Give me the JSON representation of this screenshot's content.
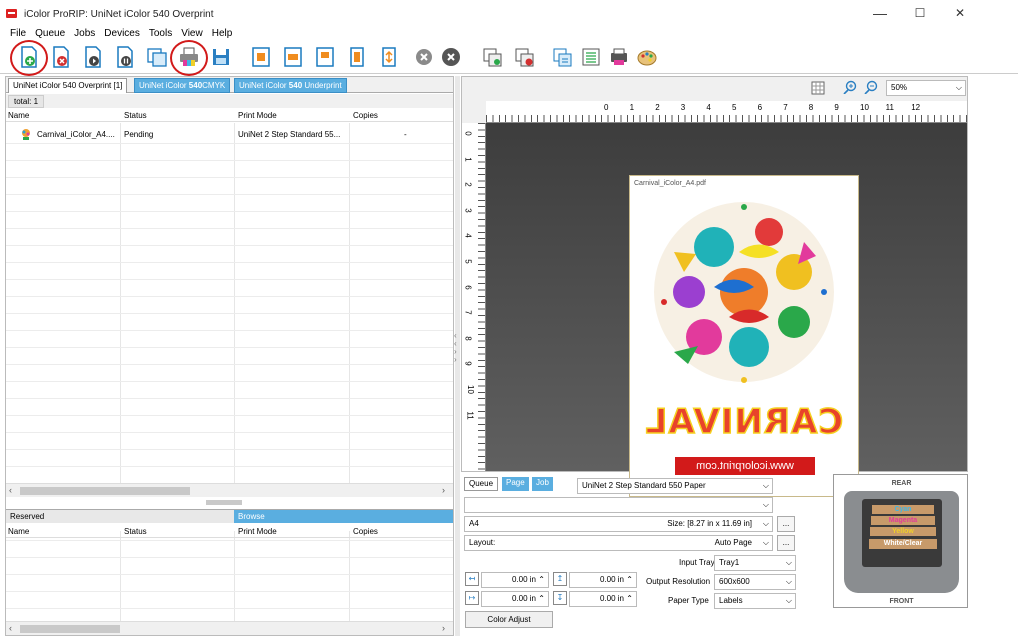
{
  "window": {
    "title": "iColor ProRIP: UniNet iColor 540 Overprint",
    "minimize": "—",
    "maximize": "☐",
    "close": "✕"
  },
  "menu": [
    "File",
    "Queue",
    "Jobs",
    "Devices",
    "Tools",
    "View",
    "Help"
  ],
  "toolbar": {
    "icons": [
      "add-job-icon",
      "delete-job-icon",
      "resume-job-icon",
      "hold-job-icon",
      "copy-job-icon",
      "print-icon",
      "save-icon",
      "fit-page-icon",
      "fit-width-icon",
      "fit-height-icon",
      "rotate-icon",
      "actual-size-icon",
      "cancel-icon",
      "stop-icon",
      "move-job-icon",
      "remove-job-icon",
      "queue-props-icon",
      "job-list-icon",
      "printer-settings-icon",
      "color-palette-icon"
    ],
    "circled": [
      "add-job-icon",
      "print-icon"
    ],
    "highlight_color": "#d21a1a"
  },
  "queue_tabs": [
    {
      "label_pre": "UniNet iColor 540 Overprint [1]",
      "active": true
    },
    {
      "label_pre": "UniNet iColor ",
      "label_bold": "540",
      "label_post": "CMYK",
      "active": false
    },
    {
      "label_pre": "UniNet iColor ",
      "label_bold": "540",
      "label_post": " Underprint",
      "active": false
    }
  ],
  "total_label": "total: 1",
  "job_table": {
    "columns": [
      "Name",
      "Status",
      "Print Mode",
      "Copies"
    ],
    "rows": [
      {
        "name": "Carnival_iColor_A4....",
        "status": "Pending",
        "print_mode": "UniNet 2 Step Standard 55...",
        "copies": "-"
      }
    ]
  },
  "bottom_tabs": {
    "reserved": "Reserved",
    "browse": "Browse"
  },
  "reserved_table": {
    "columns": [
      "Name",
      "Status",
      "Print Mode",
      "Copies"
    ]
  },
  "preview": {
    "zoom": "50%",
    "ruler_h": [
      "0",
      "1",
      "2",
      "3",
      "4",
      "5",
      "6",
      "7",
      "8",
      "9",
      "10",
      "11",
      "12"
    ],
    "ruler_v": [
      "0",
      "1",
      "2",
      "3",
      "4",
      "5",
      "6",
      "7",
      "8",
      "9",
      "10",
      "11"
    ],
    "page_file": "Carnival_iColor_A4.pdf",
    "carnival_text": "CARNIVAL",
    "url_text": "www.icolorprint.com"
  },
  "settings": {
    "tabs": [
      "Queue",
      "Page",
      "Job"
    ],
    "print_mode": "UniNet 2 Step Standard 550 Paper",
    "paper": "A4",
    "size": "Size: [8.27 in x 11.69 in]",
    "layout_label": "Layout:",
    "layout_value": "Auto Page",
    "input_tray_label": "Input Tray",
    "input_tray": "Tray1",
    "output_res_label": "Output Resolution",
    "output_res": "600x600",
    "paper_type_label": "Paper Type",
    "paper_type": "Labels",
    "margin1": "0.00 in",
    "margin2": "0.00 in",
    "margin3": "0.00 in",
    "margin4": "0.00 in",
    "ellipsis": "...",
    "color_adjust": "Color Adjust"
  },
  "printer_graphic": {
    "rear": "REAR",
    "front": "FRONT",
    "trays": [
      {
        "label": "Cyan",
        "color": "#3fb6e6"
      },
      {
        "label": "Magenta",
        "color": "#e23a9c"
      },
      {
        "label": "Yellow",
        "color": "#f0d02a"
      },
      {
        "label": "White/Clear",
        "color": "#ffffff"
      }
    ]
  }
}
